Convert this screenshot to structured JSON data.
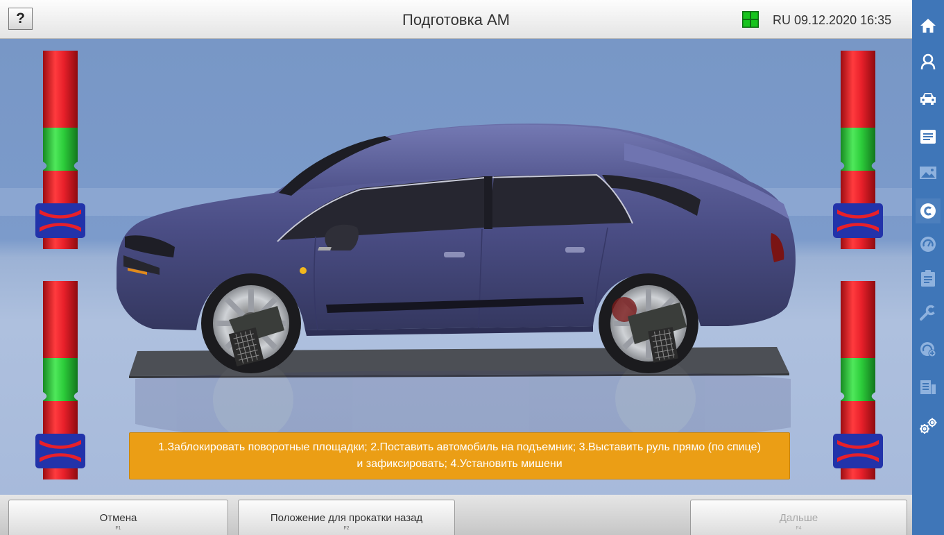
{
  "header": {
    "help_label": "?",
    "title": "Подготовка АМ",
    "status_icon": "grid-icon",
    "language": "RU",
    "datetime": "09.12.2020 16:35"
  },
  "instruction": {
    "text": "1.Заблокировать поворотные площадки; 2.Поставить автомобиль на подъемник; 3.Выставить руль прямо (по спице) и зафиксировать; 4.Установить мишени"
  },
  "footer": {
    "buttons": [
      {
        "label": "Отмена",
        "key": "F1",
        "enabled": true
      },
      {
        "label": "Положение для прокатки назад",
        "key": "F2",
        "enabled": true
      },
      {
        "label": "Дальше",
        "key": "F4",
        "enabled": false
      }
    ]
  },
  "sidebar": {
    "items": [
      {
        "icon": "home-icon",
        "active": false
      },
      {
        "icon": "customer-icon",
        "active": false
      },
      {
        "icon": "car-icon",
        "active": false
      },
      {
        "icon": "list-icon",
        "active": false
      },
      {
        "icon": "image-icon",
        "active": false
      },
      {
        "icon": "compensation-icon",
        "active": true
      },
      {
        "icon": "gauge-icon",
        "active": false
      },
      {
        "icon": "clipboard-icon",
        "active": false
      },
      {
        "icon": "wrench-icon",
        "active": false
      },
      {
        "icon": "gauge-plus-icon",
        "active": false
      },
      {
        "icon": "report-icon",
        "active": false
      },
      {
        "icon": "settings-icon",
        "active": false
      }
    ]
  },
  "colors": {
    "accent": "#3f76b8",
    "warning": "#eb9e15",
    "gauge_red": "#e8202a",
    "gauge_green": "#2ccc3a",
    "gauge_marker": "#2233aa",
    "car_body": "#4b4e86",
    "status_green": "#18c41e"
  }
}
